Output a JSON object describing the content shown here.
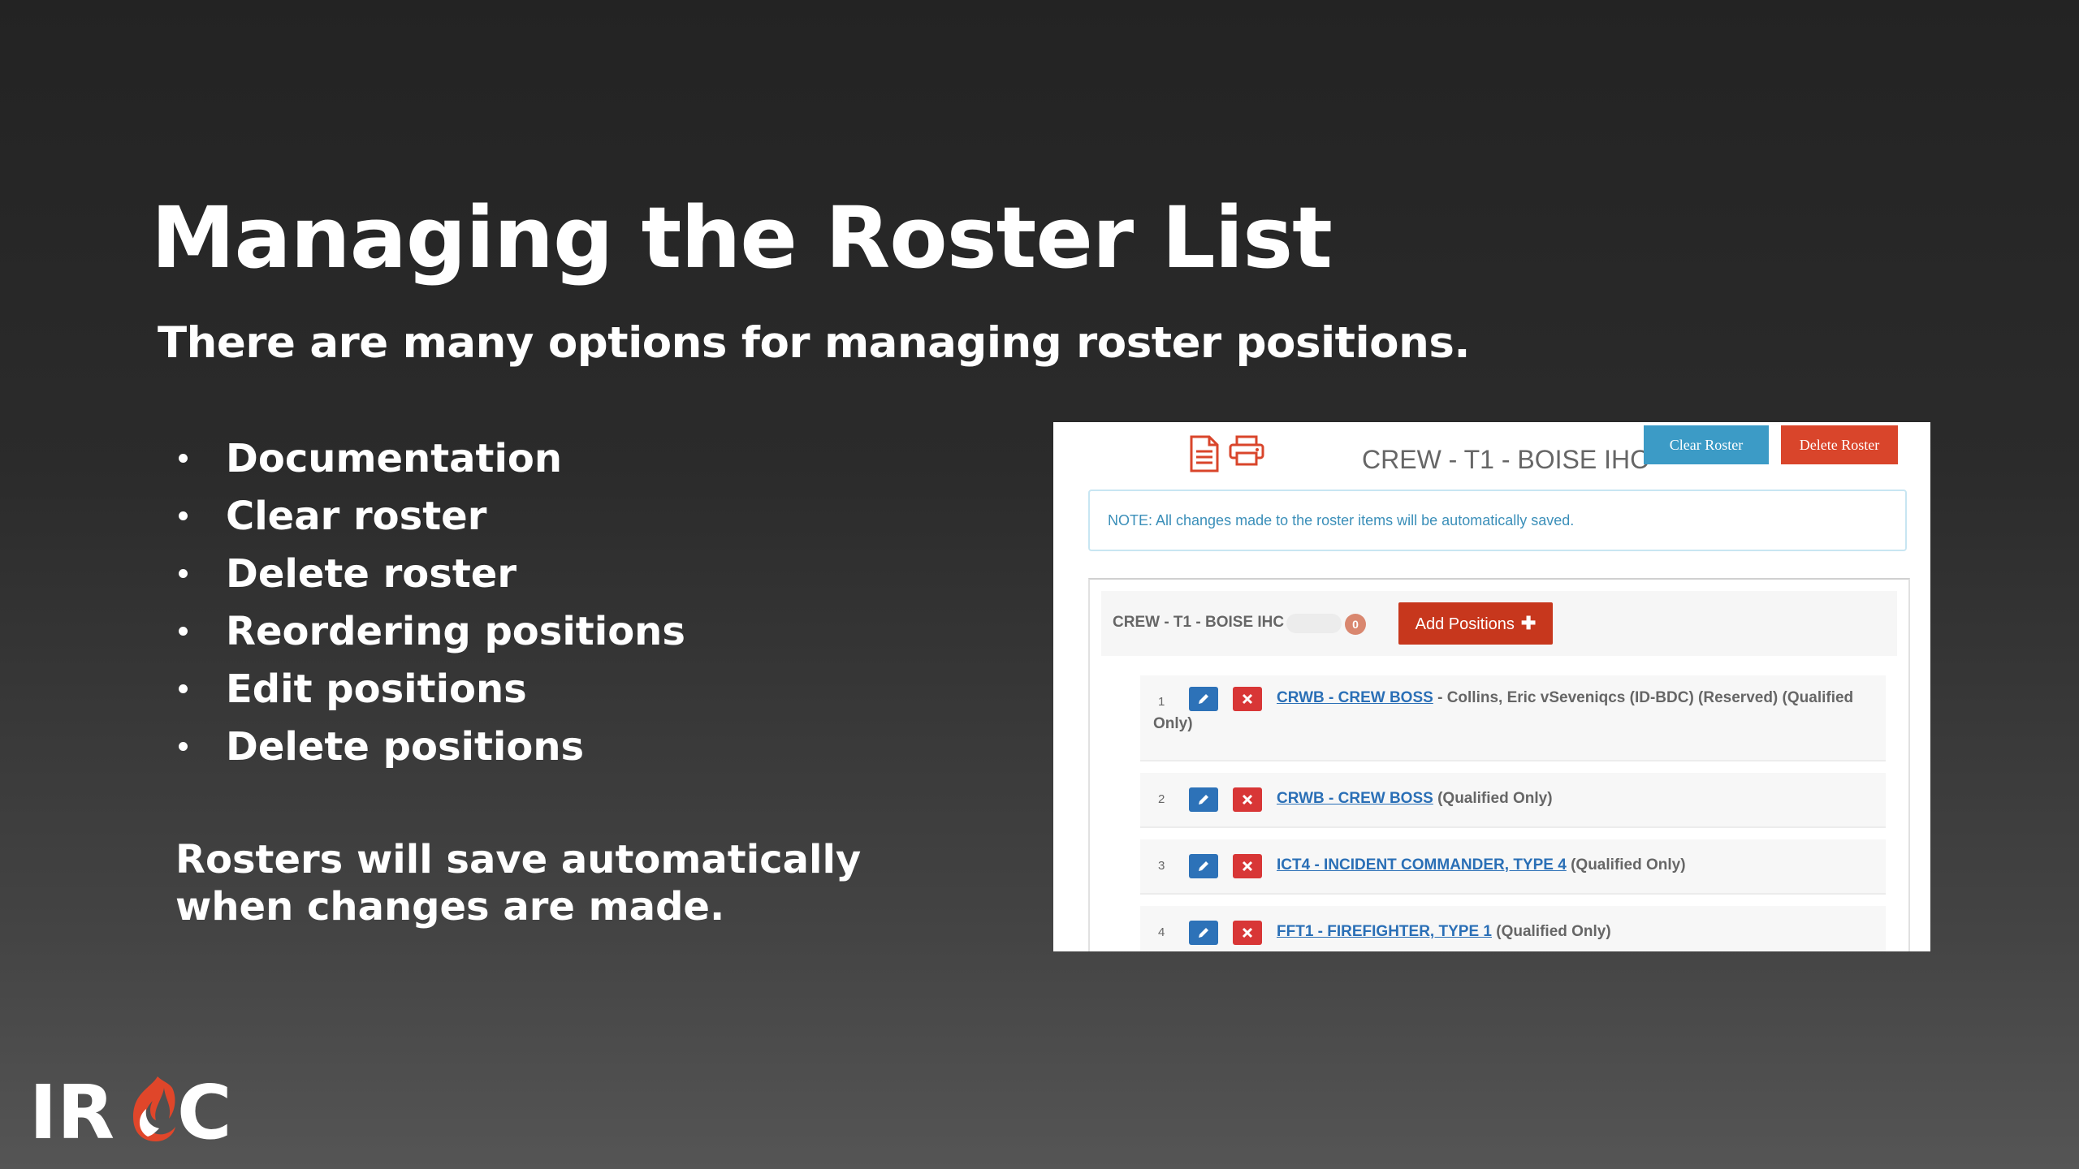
{
  "slide": {
    "title": "Managing the Roster List",
    "subtitle": "There are many options for managing roster positions.",
    "bullets": [
      "Documentation",
      "Clear roster",
      "Delete roster",
      "Reordering positions",
      "Edit positions",
      "Delete positions"
    ],
    "note": "Rosters will save automatically when changes are made."
  },
  "screenshot": {
    "roster_title": "CREW - T1 - BOISE IHC",
    "clear_roster_label": "Clear Roster",
    "delete_roster_label": "Delete Roster",
    "info_note": "NOTE: All changes made to the roster items will be automatically saved.",
    "group_title": "CREW - T1 - BOISE IHC",
    "badge_count": "0",
    "add_positions_label": "Add Positions",
    "add_positions_plus": "✚",
    "rows": [
      {
        "num": "1",
        "link": "CRWB - CREW BOSS",
        "rest_line1": " - Collins, Eric vSeveniqcs (ID-BDC) (Reserved) (Qualified",
        "rest_line2": "Only)"
      },
      {
        "num": "2",
        "link": "CRWB - CREW BOSS",
        "rest_line1": " (Qualified Only)"
      },
      {
        "num": "3",
        "link": "ICT4 - INCIDENT COMMANDER, TYPE 4",
        "rest_line1": " (Qualified Only)"
      },
      {
        "num": "4",
        "link": "FFT1 - FIREFIGHTER, TYPE 1",
        "rest_line1": " (Qualified Only)"
      }
    ],
    "icons": [
      "document-icon",
      "printer-icon",
      "pencil-icon",
      "x-icon",
      "plus-icon"
    ]
  },
  "logo": {
    "text_left": "IR",
    "text_right": "C",
    "colors": {
      "flame": "#e0462a",
      "letters": "#ffffff"
    }
  },
  "colors": {
    "clear_button": "#3c9bc6",
    "delete_button": "#d9452b",
    "add_button": "#c7371d",
    "edit_icon_bg": "#2d72b8",
    "delete_icon_bg": "#d83636",
    "link": "#2a6fb6",
    "note_text": "#3b8fb9"
  }
}
